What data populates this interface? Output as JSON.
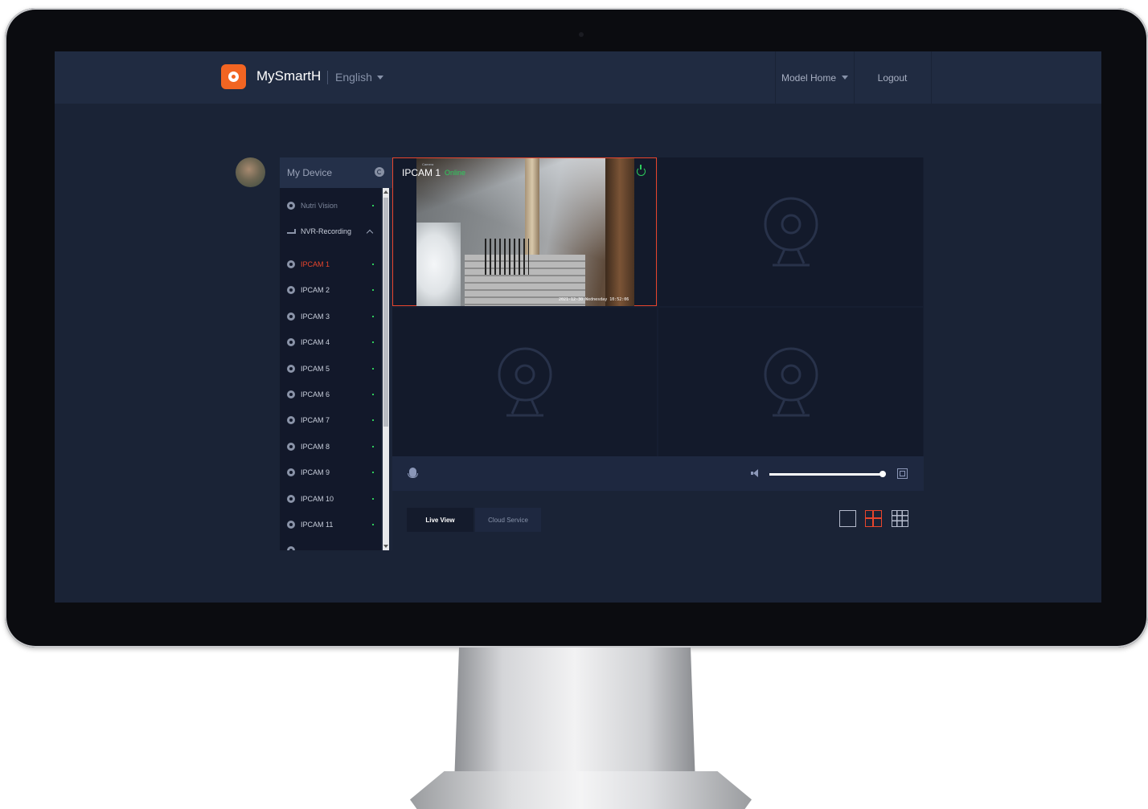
{
  "header": {
    "brand": "MySmartH",
    "language": "English",
    "home": "Model Home",
    "logout": "Logout"
  },
  "sidebar": {
    "title": "My Device",
    "devices": [
      {
        "label": "Nutri Vision",
        "online": true
      },
      {
        "label": "NVR-Recording",
        "expanded": true
      }
    ],
    "cameras": [
      {
        "label": "IPCAM 1",
        "online": true,
        "selected": true
      },
      {
        "label": "IPCAM 2",
        "online": true
      },
      {
        "label": "IPCAM 3",
        "online": true
      },
      {
        "label": "IPCAM 4",
        "online": true
      },
      {
        "label": "IPCAM 5",
        "online": true
      },
      {
        "label": "IPCAM 6",
        "online": true
      },
      {
        "label": "IPCAM 7",
        "online": true
      },
      {
        "label": "IPCAM 8",
        "online": true
      },
      {
        "label": "IPCAM 9",
        "online": true
      },
      {
        "label": "IPCAM 10",
        "online": true
      },
      {
        "label": "IPCAM 11",
        "online": true
      }
    ]
  },
  "player": {
    "active_title": "IPCAM 1",
    "active_subtitle": "Camera",
    "active_status": "Online",
    "timestamp": "2021-12-30 Wednesday 10:52:06",
    "volume_fraction": 0.97
  },
  "tabs": {
    "live": "Live View",
    "cloud": "Cloud Service"
  },
  "layout": {
    "selected": "4-split"
  },
  "colors": {
    "accent": "#e8452c",
    "online": "#2ecc5c",
    "brand": "#f26522"
  }
}
